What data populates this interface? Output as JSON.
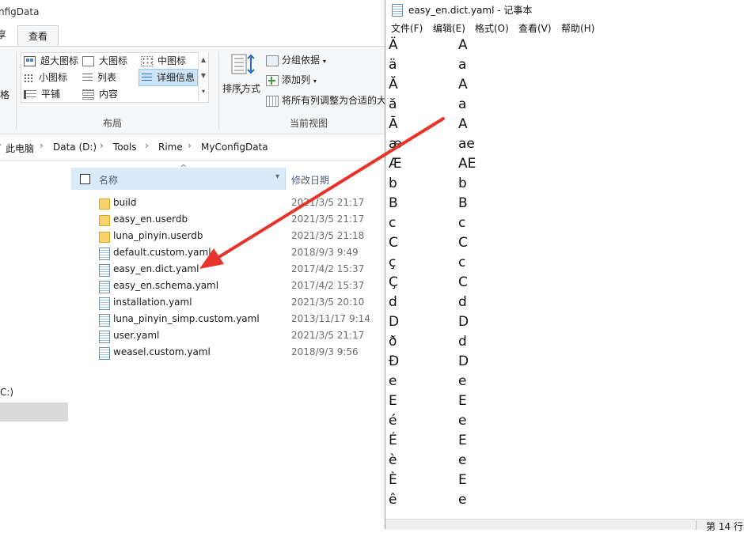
{
  "explorer": {
    "title_fragment": "nfigData",
    "ribbon_tabs": {
      "left_fragment": "享",
      "active": "查看"
    },
    "left_fragment": "格",
    "layout": {
      "items": [
        {
          "label": "超大图标",
          "icon": "extra-large-icons-icon"
        },
        {
          "label": "大图标",
          "icon": "large-icons-icon"
        },
        {
          "label": "中图标",
          "icon": "medium-icons-icon"
        },
        {
          "label": "小图标",
          "icon": "small-icons-icon"
        },
        {
          "label": "列表",
          "icon": "list-view-icon"
        },
        {
          "label": "详细信息",
          "icon": "details-view-icon",
          "selected": true
        },
        {
          "label": "平铺",
          "icon": "tiles-view-icon"
        },
        {
          "label": "内容",
          "icon": "content-view-icon"
        }
      ],
      "group_label": "布局"
    },
    "current_view": {
      "sort_label": "排序方式",
      "group_by": "分组依据",
      "add_column": "添加列",
      "fit_columns": "将所有列调整为合适的大",
      "group_label": "当前视图"
    },
    "breadcrumb": [
      "此电脑",
      "Data (D:)",
      "Tools",
      "Rime",
      "MyConfigData"
    ],
    "nav": {
      "drive_fragment": "C:)"
    },
    "columns": {
      "name": "名称",
      "date": "修改日期"
    },
    "files": [
      {
        "name": "build",
        "date": "2021/3/5 21:17",
        "type": "folder"
      },
      {
        "name": "easy_en.userdb",
        "date": "2021/3/5 21:17",
        "type": "folder"
      },
      {
        "name": "luna_pinyin.userdb",
        "date": "2021/3/5 21:18",
        "type": "folder"
      },
      {
        "name": "default.custom.yaml",
        "date": "2018/9/3 9:49",
        "type": "yaml"
      },
      {
        "name": "easy_en.dict.yaml",
        "date": "2017/4/2 15:37",
        "type": "yaml"
      },
      {
        "name": "easy_en.schema.yaml",
        "date": "2017/4/2 15:37",
        "type": "yaml"
      },
      {
        "name": "installation.yaml",
        "date": "2021/3/5 20:10",
        "type": "yaml"
      },
      {
        "name": "luna_pinyin_simp.custom.yaml",
        "date": "2013/11/17 9:14",
        "type": "yaml"
      },
      {
        "name": "user.yaml",
        "date": "2021/3/5 21:17",
        "type": "yaml"
      },
      {
        "name": "weasel.custom.yaml",
        "date": "2018/9/3 9:56",
        "type": "yaml"
      }
    ]
  },
  "notepad": {
    "title": "easy_en.dict.yaml - 记事本",
    "menu": [
      "文件(F)",
      "编辑(E)",
      "格式(O)",
      "查看(V)",
      "帮助(H)"
    ],
    "lines": [
      [
        "Ä",
        "A"
      ],
      [
        "ä",
        "a"
      ],
      [
        "Ă",
        "A"
      ],
      [
        "ă",
        "a"
      ],
      [
        "Ā",
        "A"
      ],
      [
        "æ",
        "ae"
      ],
      [
        "Æ",
        "AE"
      ],
      [
        "b",
        "b"
      ],
      [
        "B",
        "B"
      ],
      [
        "c",
        "c"
      ],
      [
        "C",
        "C"
      ],
      [
        "ç",
        "c"
      ],
      [
        "Ç",
        "C"
      ],
      [
        "d",
        "d"
      ],
      [
        "D",
        "D"
      ],
      [
        "ð",
        "d"
      ],
      [
        "Đ",
        "D"
      ],
      [
        "e",
        "e"
      ],
      [
        "E",
        "E"
      ],
      [
        "é",
        "e"
      ],
      [
        "É",
        "E"
      ],
      [
        "è",
        "e"
      ],
      [
        "È",
        "E"
      ],
      [
        "ê",
        "e"
      ]
    ],
    "status": "第 14 行"
  },
  "annotation": {
    "arrow_color": "#e8332a"
  }
}
